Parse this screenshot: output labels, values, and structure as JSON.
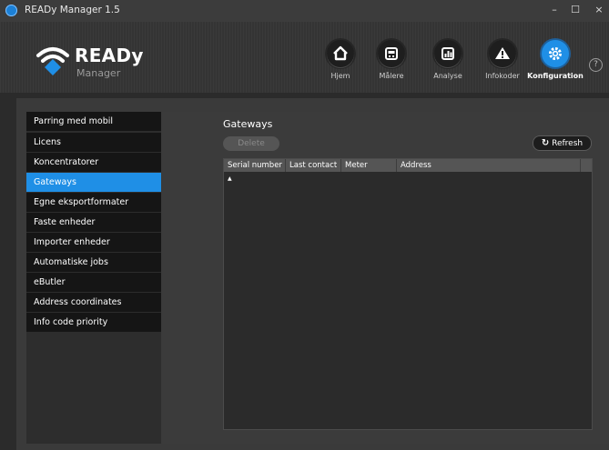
{
  "window": {
    "title": "READy Manager 1.5",
    "min_label": "–",
    "max_label": "☐",
    "close_label": "×"
  },
  "brand": {
    "name": "READy",
    "sub": "Manager"
  },
  "help_label": "?",
  "nav": [
    {
      "label": "Hjem",
      "icon": "home-icon"
    },
    {
      "label": "Målere",
      "icon": "meter-icon"
    },
    {
      "label": "Analyse",
      "icon": "chart-icon"
    },
    {
      "label": "Infokoder",
      "icon": "warning-icon"
    },
    {
      "label": "Konfiguration",
      "icon": "gear-icon",
      "active": true
    }
  ],
  "sidebar": {
    "items": [
      {
        "label": "Parring med mobil"
      },
      {
        "label": "Licens"
      },
      {
        "label": "Koncentratorer"
      },
      {
        "label": "Gateways",
        "active": true
      },
      {
        "label": "Egne eksportformater"
      },
      {
        "label": "Faste enheder"
      },
      {
        "label": "Importer enheder"
      },
      {
        "label": "Automatiske jobs"
      },
      {
        "label": "eButler"
      },
      {
        "label": "Address coordinates"
      },
      {
        "label": "Info code priority"
      }
    ]
  },
  "main": {
    "title": "Gateways",
    "delete_label": "Delete",
    "refresh_label": "Refresh",
    "columns": [
      "Serial number",
      "Last contact",
      "Meter",
      "Address"
    ],
    "sort_indicator": "▲"
  },
  "colors": {
    "accent": "#1f8fe6",
    "sidebar_item": "#151515",
    "background": "#2b2b2b"
  }
}
